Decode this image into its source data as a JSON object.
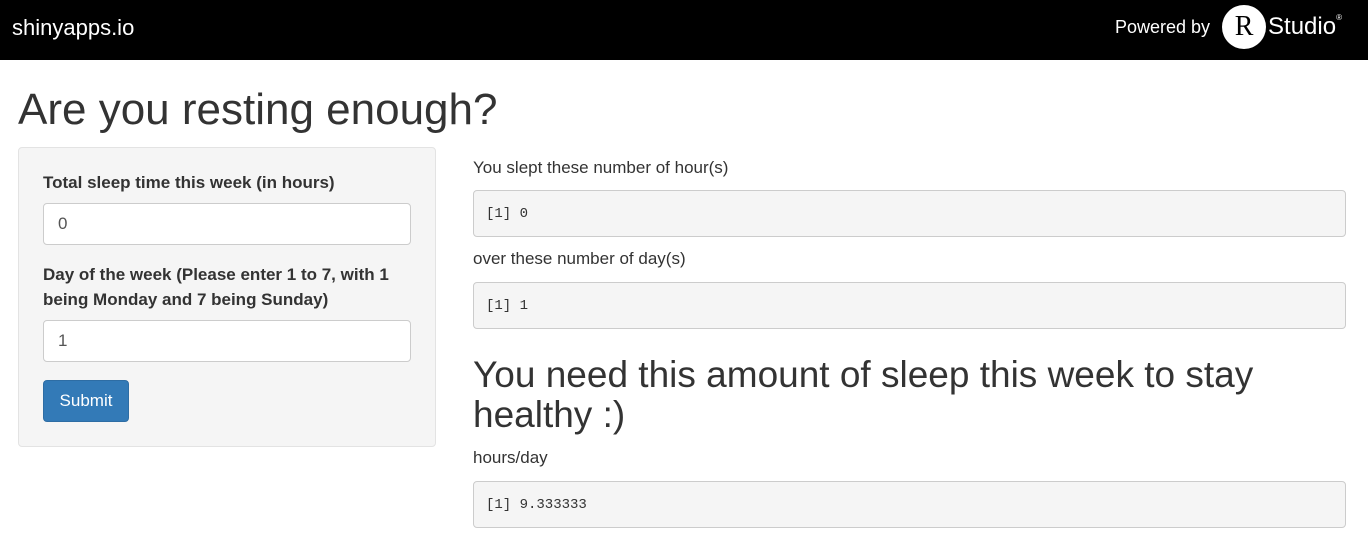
{
  "header": {
    "brand": "shinyapps.io",
    "powered_by": "Powered by",
    "logo_letter": "R",
    "logo_word": "Studio",
    "logo_mark": "®"
  },
  "page": {
    "title": "Are you resting enough?"
  },
  "sidebar": {
    "sleep_label": "Total sleep time this week (in hours)",
    "sleep_value": "0",
    "day_label": "Day of the week (Please enter 1 to 7, with 1 being Monday and 7 being Sunday)",
    "day_value": "1",
    "submit_label": "Submit",
    "submit_color": "#337ab7"
  },
  "main": {
    "hours_label": "You slept these number of hour(s)",
    "hours_output": "[1] 0",
    "days_label": "over these number of day(s)",
    "days_output": "[1] 1",
    "result_heading": "You need this amount of sleep this week to stay healthy :)",
    "result_unit_label": "hours/day",
    "result_output": "[1] 9.333333"
  }
}
